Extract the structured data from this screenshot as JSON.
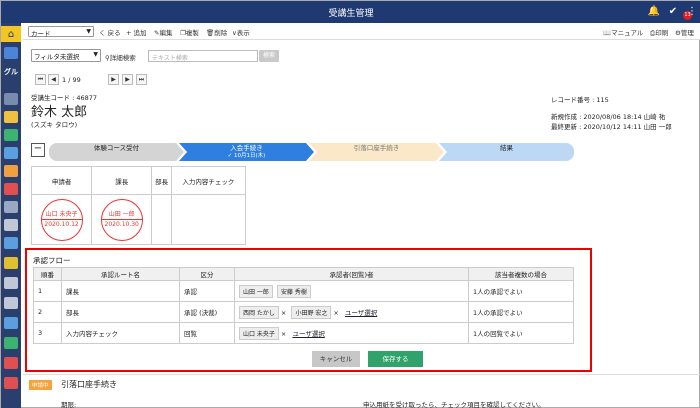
{
  "header": {
    "title": "受講生管理",
    "badge": "13"
  },
  "sidebar": {
    "label": "グル"
  },
  "toolbar": {
    "select_value": "カード",
    "back": "く 戻る",
    "add": "+ 追加",
    "edit": "編集",
    "copy": "複製",
    "delete": "削除",
    "view": "表示",
    "manual": "マニュアル",
    "print": "印刷",
    "admin": "管理"
  },
  "filter": {
    "select_value": "フィルタ未選択",
    "advanced": "詳細検索",
    "search_placeholder": "テキスト検索",
    "search_button": "検索"
  },
  "pager": {
    "current": "1 / 99"
  },
  "record": {
    "code_label": "受講生コード : 46877",
    "name": "鈴木 太郎",
    "kana": "(スズキ タロウ)",
    "number": "レコード番号 : 115",
    "created": "新規作成 : 2020/08/06 18:14 山崎 祐",
    "updated": "最終更新 : 2020/10/12 14:11 山田 一郎"
  },
  "steps": [
    {
      "label": "体験コース受付"
    },
    {
      "label": "入会手続き",
      "date": "✓ 10月1日(木)"
    },
    {
      "label": "引落口座手続き"
    },
    {
      "label": "結果"
    }
  ],
  "stamps": {
    "headers": [
      "申請者",
      "課長",
      "部長",
      "入力内容チェック"
    ],
    "cells": [
      {
        "name": "山口 未央子",
        "date": "2020.10.12"
      },
      {
        "name": "山田 一郎",
        "date": "2020.10.30"
      }
    ]
  },
  "approval": {
    "title": "承認フロー",
    "columns": [
      "順番",
      "承認ルート名",
      "区分",
      "承認者(回覧)者",
      "該当者複数の場合"
    ],
    "rows": [
      {
        "order": "1",
        "route": "課長",
        "type": "承認",
        "approvers": [
          "山田 一郎",
          "安藤 秀樹"
        ],
        "removable": false,
        "user_select": "",
        "multi": "1人の承認でよい"
      },
      {
        "order": "2",
        "route": "部長",
        "type": "承認 (決裁)",
        "approvers": [
          "西岡 たかし",
          "小田野 宏之"
        ],
        "removable": true,
        "user_select": "ユーザ選択",
        "multi": "1人の承認でよい"
      },
      {
        "order": "3",
        "route": "入力内容チェック",
        "type": "回覧",
        "approvers": [
          "山口 未央子"
        ],
        "removable": true,
        "user_select": "ユーザ選択",
        "multi": "1人の回覧でよい"
      }
    ],
    "cancel": "キャンセル",
    "save": "保存する"
  },
  "bottom": {
    "tag": "申請中",
    "title": "引落口座手続き",
    "field": "期限:",
    "note": "申込用紙を受け取ったら、チェック項目を確認してください。"
  },
  "colors": {
    "header": "#1f3a73",
    "sidebar": "#2a3f6e",
    "accent": "#2f7fe0",
    "save": "#2fa36b",
    "highlight": "#e00"
  }
}
